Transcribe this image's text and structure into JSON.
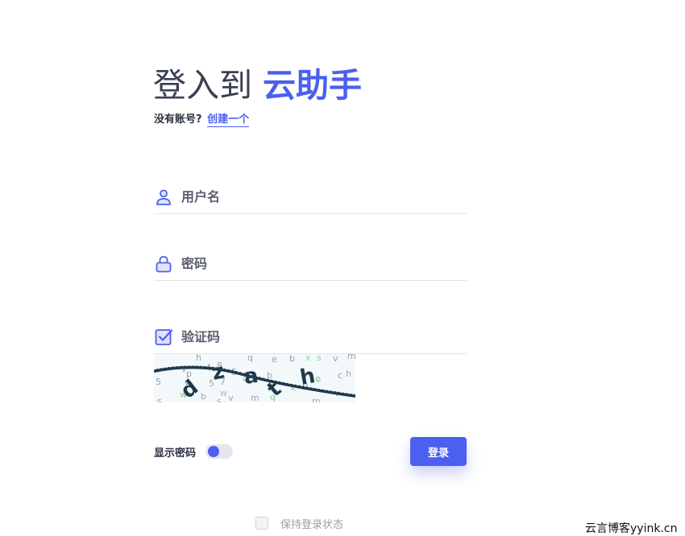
{
  "header": {
    "title_prefix": "登入到",
    "title_brand": "云助手",
    "no_account_text": "没有账号?",
    "create_link": "创建一个"
  },
  "form": {
    "username_placeholder": "用户名",
    "password_placeholder": "密码",
    "captcha_placeholder": "验证码",
    "captcha_chars": [
      "d",
      "z",
      "a",
      "t",
      "h"
    ],
    "show_password_label": "显示密码",
    "show_password_on": true,
    "login_button": "登录",
    "keep_logged_in_label": "保持登录状态"
  },
  "watermark": "云言博客yyink.cn",
  "colors": {
    "accent": "#4b5ff0",
    "text": "#333a4d",
    "divider": "#e3e5ea"
  },
  "icons": {
    "username": "user-icon",
    "password": "lock-icon",
    "captcha": "checkbox-icon"
  }
}
